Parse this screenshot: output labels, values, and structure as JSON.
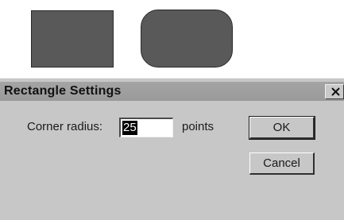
{
  "preview": {
    "square_shape": "square-rectangle",
    "rounded_shape": "rounded-rectangle",
    "fill_color": "#595959"
  },
  "dialog": {
    "title": "Rectangle Settings",
    "close_glyph": "×",
    "corner_radius_label": "Corner radius:",
    "corner_radius_value": "25",
    "unit_label": "points",
    "ok_label": "OK",
    "cancel_label": "Cancel"
  },
  "icons": {
    "close": "close-icon"
  }
}
